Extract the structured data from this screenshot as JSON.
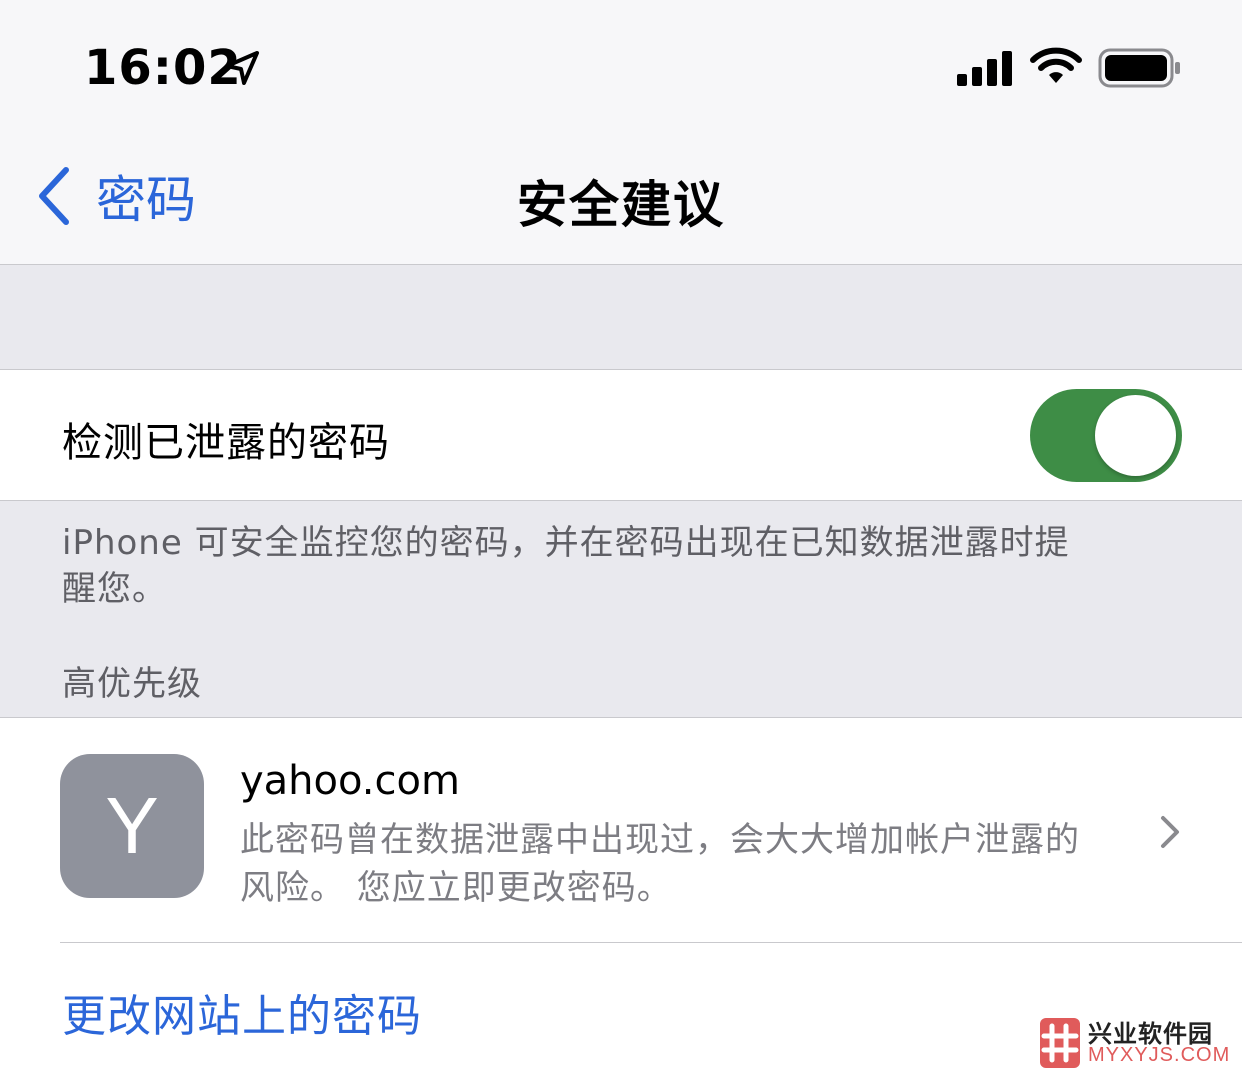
{
  "status_bar": {
    "time": "16:02",
    "icons": [
      "location-arrow-icon",
      "cellular-signal-icon",
      "wifi-icon",
      "battery-icon"
    ]
  },
  "nav": {
    "back_label": "密码",
    "title": "安全建议"
  },
  "toggle_row": {
    "label": "检测已泄露的密码",
    "enabled": true
  },
  "footer_note": "iPhone 可安全监控您的密码，并在密码出现在已知数据泄露时提醒您。",
  "section_header": "高优先级",
  "item": {
    "icon_letter": "Y",
    "site": "yahoo.com",
    "description": "此密码曾在数据泄露中出现过，会大大增加帐户泄露的风险。 您应立即更改密码。"
  },
  "action_link": "更改网站上的密码",
  "watermark": {
    "name": "兴业软件园",
    "domain": "MYXYJS.COM"
  },
  "colors": {
    "accent": "#2b66d9",
    "toggle_on": "#3e8d46",
    "group_background": "#e9e9ee",
    "site_icon": "#8f929c"
  }
}
